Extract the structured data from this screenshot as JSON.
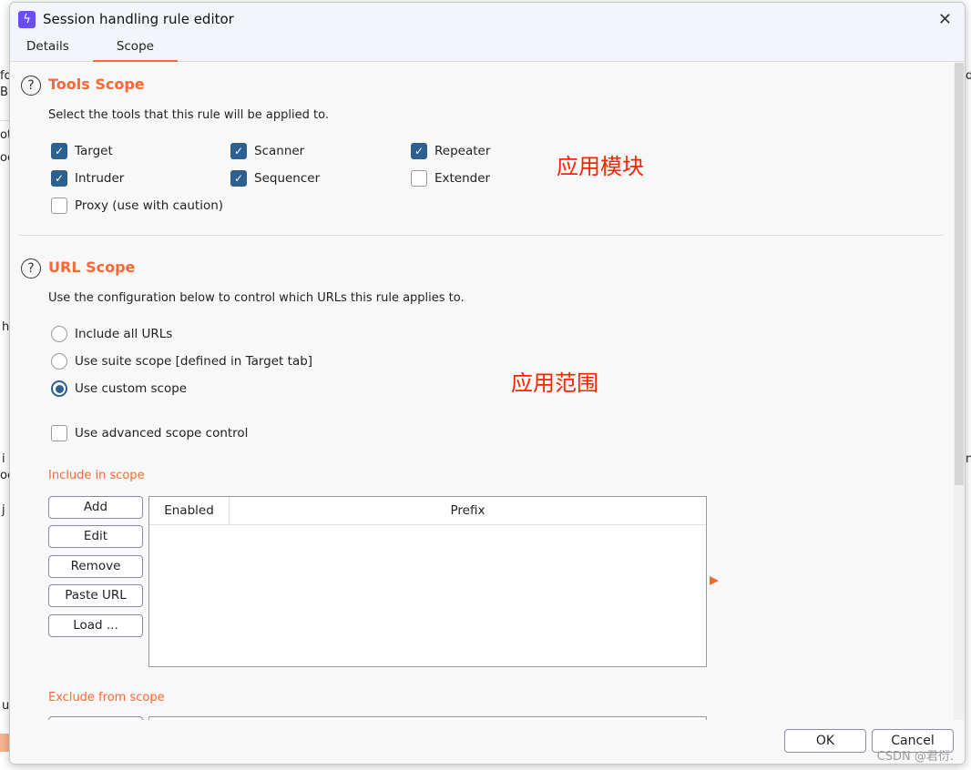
{
  "background_fragments": [
    "fo",
    "Bu",
    "ot",
    "oc",
    "h",
    "i",
    "oc",
    "j",
    "u",
    "d",
    "n"
  ],
  "window": {
    "title": "Session handling rule editor",
    "close": "✕"
  },
  "tabs": [
    {
      "label": "Details"
    },
    {
      "label": "Scope",
      "active": true
    }
  ],
  "tools_scope": {
    "title": "Tools Scope",
    "help": "?",
    "description": "Select the tools that this rule will be applied to.",
    "tools": [
      {
        "label": "Target",
        "checked": true
      },
      {
        "label": "Scanner",
        "checked": true
      },
      {
        "label": "Repeater",
        "checked": true
      },
      {
        "label": "Intruder",
        "checked": true
      },
      {
        "label": "Sequencer",
        "checked": true
      },
      {
        "label": "Extender",
        "checked": false
      },
      {
        "label": "Proxy (use with caution)",
        "checked": false
      }
    ],
    "annotation": "应用模块"
  },
  "url_scope": {
    "title": "URL Scope",
    "help": "?",
    "description": "Use the configuration below to control which URLs this rule applies to.",
    "options": [
      {
        "label": "Include all URLs",
        "selected": false
      },
      {
        "label": "Use suite scope [defined in Target tab]",
        "selected": false
      },
      {
        "label": "Use custom scope",
        "selected": true
      }
    ],
    "advanced": {
      "label": "Use advanced scope control",
      "checked": false
    },
    "annotation": "应用范围",
    "include_label": "Include in scope",
    "buttons": [
      "Add",
      "Edit",
      "Remove",
      "Paste URL",
      "Load ..."
    ],
    "columns": [
      "Enabled",
      "Prefix"
    ],
    "rows": [],
    "exclude_label": "Exclude from scope"
  },
  "footer": {
    "ok": "OK",
    "cancel": "Cancel"
  },
  "watermark": "CSDN @君衍."
}
